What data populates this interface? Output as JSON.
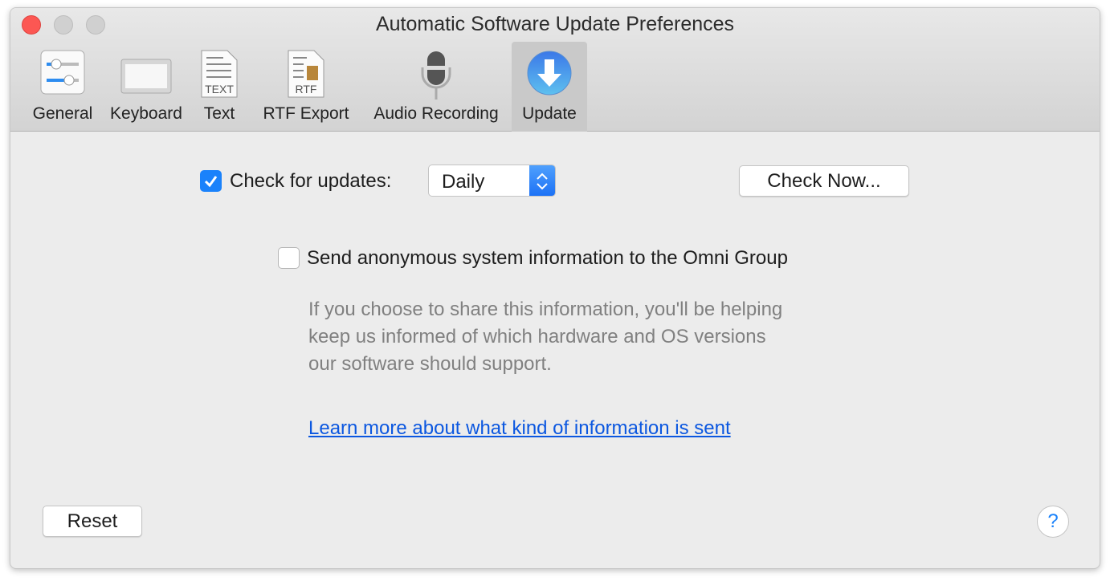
{
  "window": {
    "title": "Automatic Software Update Preferences"
  },
  "toolbar": {
    "items": [
      {
        "label": "General",
        "icon": "sliders-icon"
      },
      {
        "label": "Keyboard",
        "icon": "keyboard-icon"
      },
      {
        "label": "Text",
        "icon": "text-document-icon",
        "badge": "TEXT"
      },
      {
        "label": "RTF Export",
        "icon": "rtf-document-icon",
        "badge": "RTF"
      },
      {
        "label": "Audio Recording",
        "icon": "microphone-icon"
      },
      {
        "label": "Update",
        "icon": "download-arrow-icon",
        "selected": true
      }
    ]
  },
  "updates": {
    "check_label": "Check for updates:",
    "checked": true,
    "frequency": "Daily",
    "check_now": "Check Now..."
  },
  "anonymous": {
    "label": "Send anonymous system information to the Omni Group",
    "checked": false,
    "description": [
      "If you choose to share this information, you'll be helping",
      "keep us informed of which hardware and OS versions",
      "our software should support."
    ],
    "link": "Learn more about what kind of information is sent"
  },
  "footer": {
    "reset": "Reset",
    "help": "?"
  },
  "colors": {
    "accent": "#1a82fb",
    "link": "#0b57e0",
    "close": "#fc5753"
  }
}
